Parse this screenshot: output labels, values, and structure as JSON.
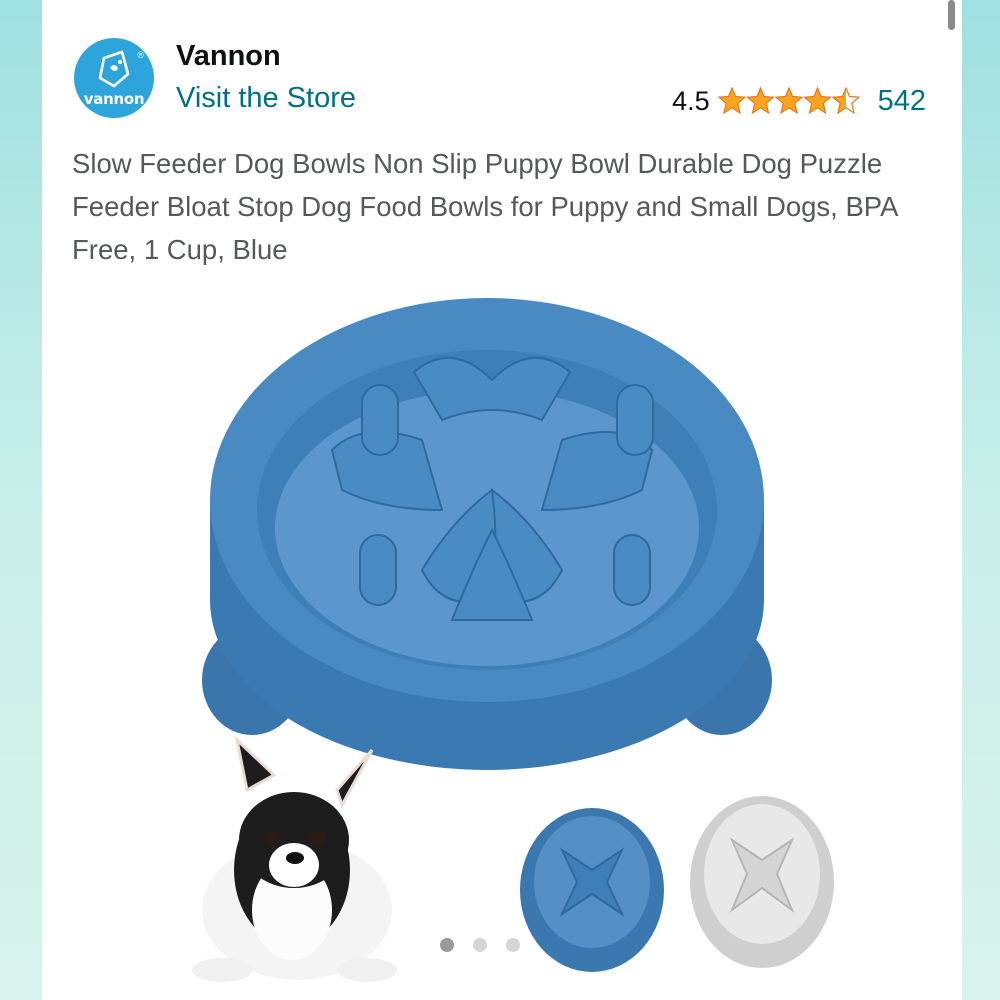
{
  "store": {
    "logo_text": "vannon",
    "logo_registered": "®",
    "brand_name": "Vannon",
    "visit_label": "Visit the Store"
  },
  "rating": {
    "score": "4.5",
    "stars_value": 4.5,
    "stars_max": 5,
    "review_count": "542",
    "star_color": "#ffa41c"
  },
  "product": {
    "title": "Slow Feeder Dog Bowls Non Slip Puppy Bowl Durable Dog Puzzle Feeder Bloat Stop Dog Food Bowls for Puppy and Small Dogs, BPA Free, 1 Cup, Blue",
    "image_subject": "blue slow feeder bowl with chihuahua puppy, blue and grey bowl variants"
  },
  "gallery": {
    "total_images": 3,
    "active_index": 0
  },
  "colors": {
    "link": "#007185",
    "text": "#0f1111",
    "muted_text": "#565959",
    "bowl_blue": "#3f7fb8",
    "logo_blue": "#2ea4dc"
  }
}
